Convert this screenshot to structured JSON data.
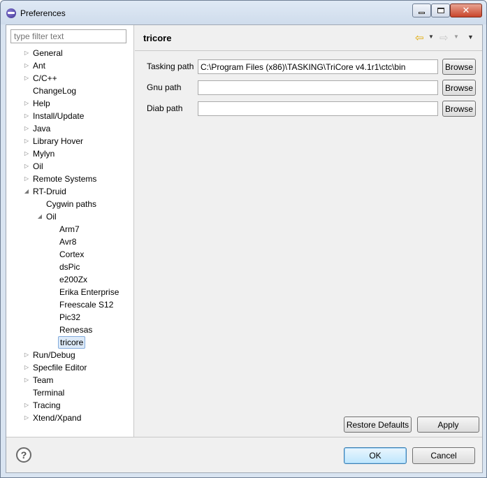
{
  "window": {
    "title": "Preferences",
    "minimize_glyph": "",
    "close_glyph": "✕"
  },
  "filter": {
    "placeholder": "type filter text",
    "value": ""
  },
  "tree": [
    {
      "label": "General",
      "level": 0,
      "arrow": "collapsed"
    },
    {
      "label": "Ant",
      "level": 0,
      "arrow": "collapsed"
    },
    {
      "label": "C/C++",
      "level": 0,
      "arrow": "collapsed"
    },
    {
      "label": "ChangeLog",
      "level": 0,
      "arrow": "none"
    },
    {
      "label": "Help",
      "level": 0,
      "arrow": "collapsed"
    },
    {
      "label": "Install/Update",
      "level": 0,
      "arrow": "collapsed"
    },
    {
      "label": "Java",
      "level": 0,
      "arrow": "collapsed"
    },
    {
      "label": "Library Hover",
      "level": 0,
      "arrow": "collapsed"
    },
    {
      "label": "Mylyn",
      "level": 0,
      "arrow": "collapsed"
    },
    {
      "label": "Oil",
      "level": 0,
      "arrow": "collapsed"
    },
    {
      "label": "Remote Systems",
      "level": 0,
      "arrow": "collapsed"
    },
    {
      "label": "RT-Druid",
      "level": 0,
      "arrow": "expanded"
    },
    {
      "label": "Cygwin paths",
      "level": 1,
      "arrow": "none"
    },
    {
      "label": "Oil",
      "level": 1,
      "arrow": "expanded"
    },
    {
      "label": "Arm7",
      "level": 2,
      "arrow": "none"
    },
    {
      "label": "Avr8",
      "level": 2,
      "arrow": "none"
    },
    {
      "label": "Cortex",
      "level": 2,
      "arrow": "none"
    },
    {
      "label": "dsPic",
      "level": 2,
      "arrow": "none"
    },
    {
      "label": "e200Zx",
      "level": 2,
      "arrow": "none"
    },
    {
      "label": "Erika Enterprise",
      "level": 2,
      "arrow": "none"
    },
    {
      "label": "Freescale S12",
      "level": 2,
      "arrow": "none"
    },
    {
      "label": "Pic32",
      "level": 2,
      "arrow": "none"
    },
    {
      "label": "Renesas",
      "level": 2,
      "arrow": "none"
    },
    {
      "label": "tricore",
      "level": 2,
      "arrow": "none",
      "selected": true
    },
    {
      "label": "Run/Debug",
      "level": 0,
      "arrow": "collapsed"
    },
    {
      "label": "Specfile Editor",
      "level": 0,
      "arrow": "collapsed"
    },
    {
      "label": "Team",
      "level": 0,
      "arrow": "collapsed"
    },
    {
      "label": "Terminal",
      "level": 0,
      "arrow": "none"
    },
    {
      "label": "Tracing",
      "level": 0,
      "arrow": "collapsed"
    },
    {
      "label": "Xtend/Xpand",
      "level": 0,
      "arrow": "collapsed"
    }
  ],
  "page": {
    "title": "tricore",
    "rows": [
      {
        "label": "Tasking path",
        "value": "C:\\Program Files (x86)\\TASKING\\TriCore v4.1r1\\ctc\\bin",
        "button": "Browse"
      },
      {
        "label": "Gnu path",
        "value": "",
        "button": "Browse"
      },
      {
        "label": "Diab path",
        "value": "",
        "button": "Browse"
      }
    ],
    "restore_defaults": "Restore Defaults",
    "apply": "Apply"
  },
  "nav": {
    "back_icon": "⇦",
    "forward_icon": "⇨",
    "dropdown_icon": "▼"
  },
  "bottom": {
    "help_icon": "?",
    "ok": "OK",
    "cancel": "Cancel"
  },
  "colors": {
    "accent": "#3c7fb1",
    "selection_bg": "#ddeaf8",
    "back_arrow": "#e0a800"
  }
}
